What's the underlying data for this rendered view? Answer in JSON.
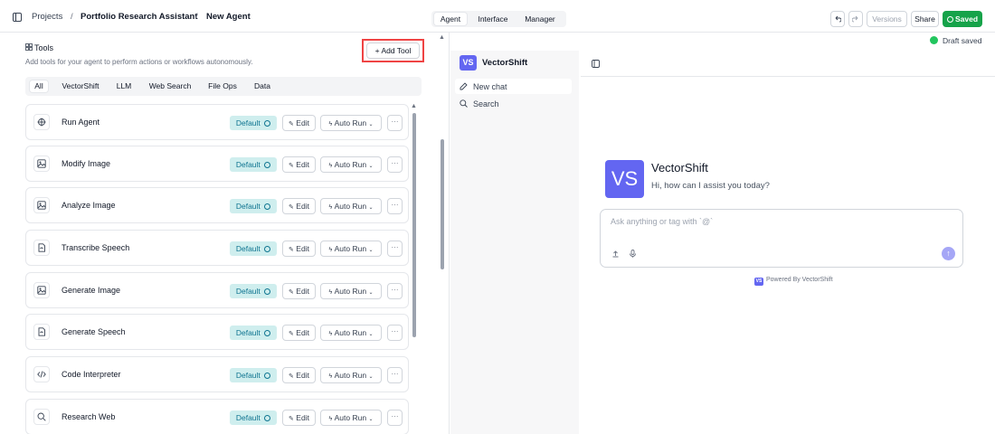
{
  "breadcrumb": {
    "items": [
      "Projects",
      "Portfolio Research Assistant",
      "New Agent"
    ],
    "separator": "/"
  },
  "view_tabs": [
    "Agent",
    "Interface",
    "Manager"
  ],
  "active_view_tab": "Agent",
  "header_actions": {
    "versions_label": "Versions",
    "share_label": "Share",
    "saved_label": "Saved"
  },
  "tools_panel": {
    "title": "Tools",
    "subtitle": "Add tools for your agent to perform actions or workflows autonomously.",
    "add_tool_label": "+ Add Tool",
    "filter_tabs": [
      "All",
      "VectorShift",
      "LLM",
      "Web Search",
      "File Ops",
      "Data"
    ],
    "active_filter": "All",
    "tools": [
      {
        "name": "Run Agent",
        "icon": "agent-icon",
        "status": "Default",
        "edit_label": "Edit",
        "run_label": "Auto Run"
      },
      {
        "name": "Modify Image",
        "icon": "image-icon",
        "status": "Default",
        "edit_label": "Edit",
        "run_label": "Auto Run"
      },
      {
        "name": "Analyze Image",
        "icon": "image-icon",
        "status": "Default",
        "edit_label": "Edit",
        "run_label": "Auto Run"
      },
      {
        "name": "Transcribe Speech",
        "icon": "speech-file-icon",
        "status": "Default",
        "edit_label": "Edit",
        "run_label": "Auto Run"
      },
      {
        "name": "Generate Image",
        "icon": "image-icon",
        "status": "Default",
        "edit_label": "Edit",
        "run_label": "Auto Run"
      },
      {
        "name": "Generate Speech",
        "icon": "speech-file-icon",
        "status": "Default",
        "edit_label": "Edit",
        "run_label": "Auto Run"
      },
      {
        "name": "Code Interpreter",
        "icon": "code-icon",
        "status": "Default",
        "edit_label": "Edit",
        "run_label": "Auto Run"
      },
      {
        "name": "Research Web",
        "icon": "search-icon",
        "status": "Default",
        "edit_label": "Edit",
        "run_label": "Auto Run"
      }
    ]
  },
  "preview": {
    "draft_status": "Draft saved",
    "logo_text": "VS",
    "app_name": "VectorShift",
    "sidebar": {
      "new_chat_label": "New chat",
      "search_label": "Search"
    },
    "greeting": "Hi, how can I assist you today?",
    "input_placeholder": "Ask anything or tag with `@`",
    "powered_by": "Powered By VectorShift",
    "accent_color": "#6366f1"
  },
  "colors": {
    "saved_green": "#16a34a",
    "highlight_red": "#ef4444",
    "badge_bg": "#cfeeee",
    "badge_text": "#0e7490"
  }
}
